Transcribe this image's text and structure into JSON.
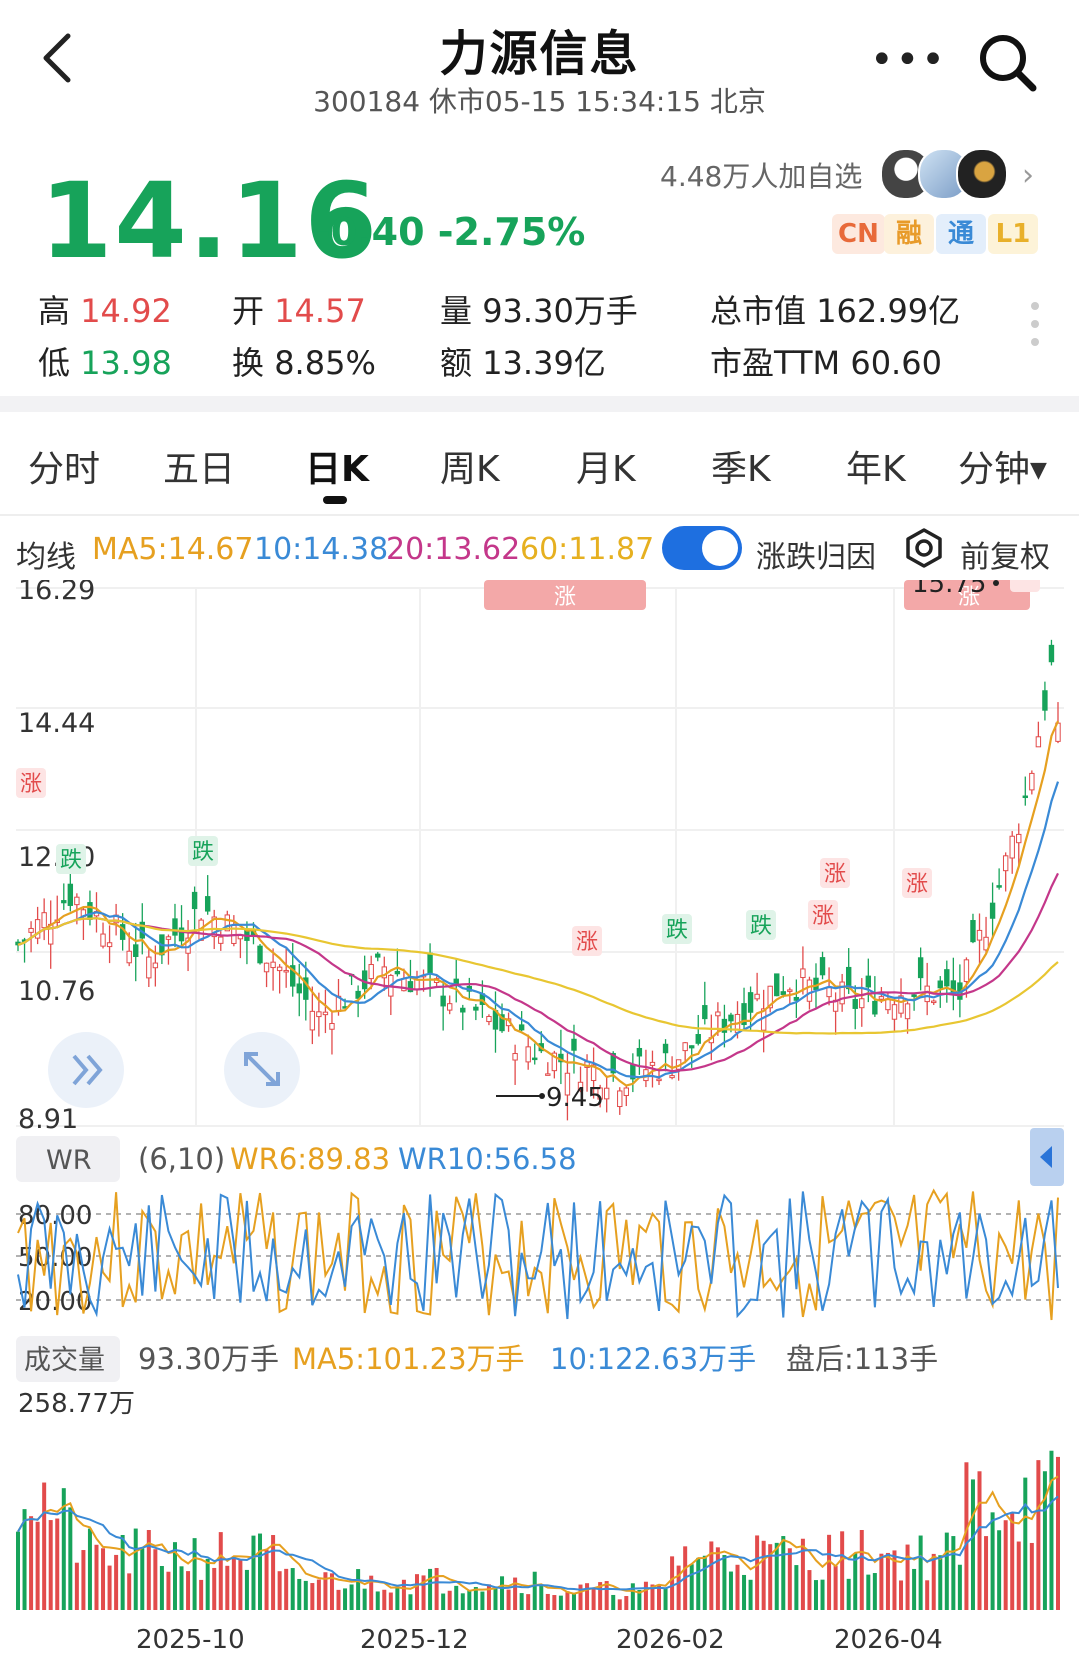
{
  "header": {
    "title": "力源信息",
    "subtitle": "300184 休市05-15 15:34:15 北京",
    "more_glyph": "•••"
  },
  "quote": {
    "price": "14.16",
    "change": "-0.40 -2.75%",
    "watchers": "4.48万人加自选",
    "tags": [
      "CN",
      "融",
      "通",
      "L1"
    ]
  },
  "stats": {
    "high_label": "高",
    "high": "14.92",
    "open_label": "开",
    "open": "14.57",
    "volume_label": "量",
    "volume": "93.30万手",
    "mcap_label": "总市值",
    "mcap": "162.99亿",
    "low_label": "低",
    "low": "13.98",
    "turnover_label": "换",
    "turnover": "8.85%",
    "amount_label": "额",
    "amount": "13.39亿",
    "pe_label": "市盈TTM",
    "pe": "60.60"
  },
  "tabs": [
    "分时",
    "五日",
    "日K",
    "周K",
    "月K",
    "季K",
    "年K",
    "分钟"
  ],
  "active_tab": "日K",
  "ma_bar": {
    "label": "均线",
    "ma5": "MA5:14.67",
    "ma10": "10:14.38",
    "ma20": "20:13.62",
    "ma60": "60:11.87",
    "toggle_label": "涨跌归因",
    "adjust_label": "前复权"
  },
  "colors": {
    "up": "#e24b4b",
    "down": "#17a35a",
    "ma5": "#e6a020",
    "ma10": "#3a8ad6",
    "ma20": "#c4378a",
    "ma60": "#e8c632",
    "accent": "#1e6fe0"
  },
  "price_chart": {
    "y_ticks": [
      "16.29",
      "14.44",
      "12.60",
      "10.76",
      "8.91"
    ],
    "high_mark": "15.75",
    "low_mark": "9.45",
    "event_up": "涨",
    "event_down": "跌"
  },
  "wr": {
    "label": "WR",
    "params": "(6,10)",
    "wr6": "WR6:89.83",
    "wr10": "WR10:56.58",
    "y_ticks": [
      "80.00",
      "50.00",
      "20.00"
    ]
  },
  "volume": {
    "label": "成交量",
    "value": "93.30万手",
    "ma5": "MA5:101.23万手",
    "ma10": "10:122.63万手",
    "after": "盘后:113手",
    "y_max": "258.77万"
  },
  "x_axis": [
    "2025-10",
    "2025-12",
    "2026-02",
    "2026-04"
  ]
}
